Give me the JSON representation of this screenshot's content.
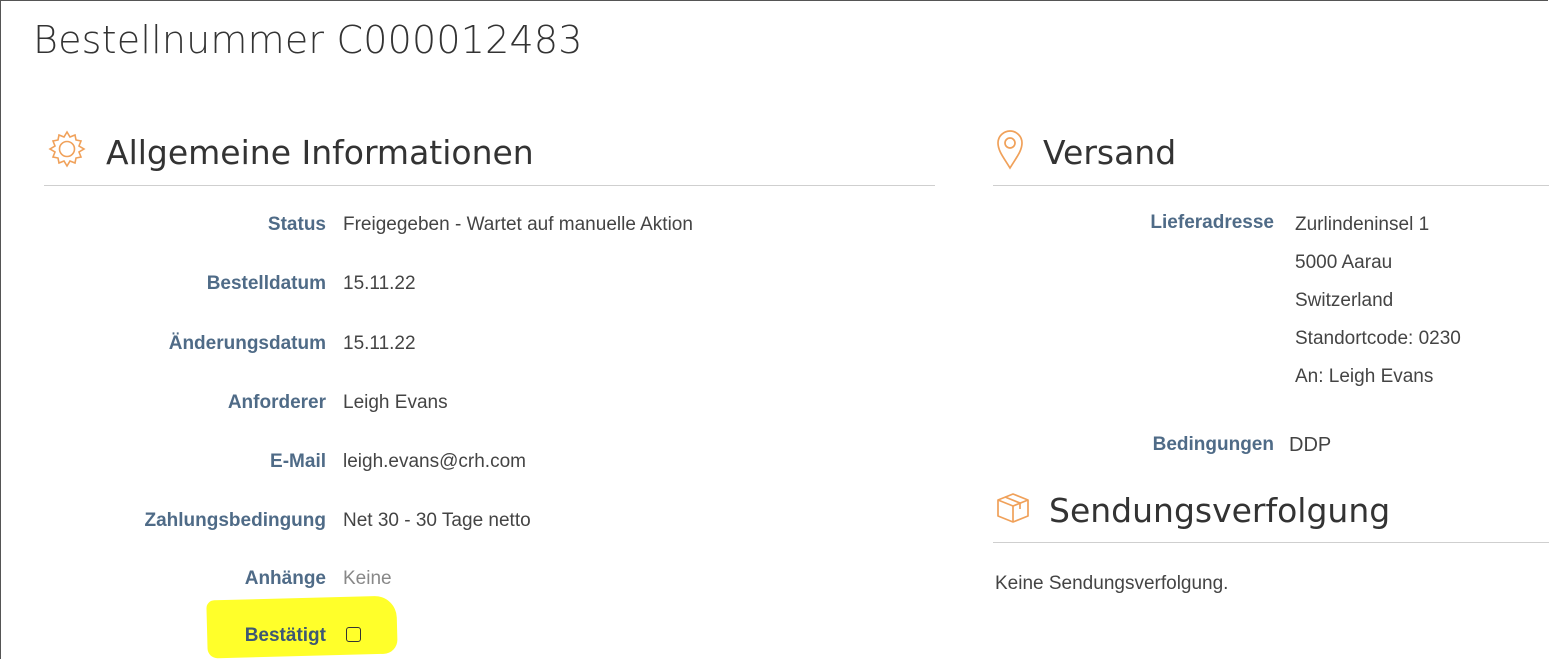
{
  "page_title": "Bestellnummer C000012483",
  "general": {
    "title": "Allgemeine Informationen",
    "icon": "gear-icon",
    "fields": [
      {
        "label": "Status",
        "value": "Freigegeben - Wartet auf manuelle Aktion"
      },
      {
        "label": "Bestelldatum",
        "value": "15.11.22"
      },
      {
        "label": "Änderungsdatum",
        "value": "15.11.22"
      },
      {
        "label": "Anforderer",
        "value": "Leigh Evans"
      },
      {
        "label": "E-Mail",
        "value": "leigh.evans@crh.com"
      },
      {
        "label": "Zahlungsbedingung",
        "value": "Net 30 - 30 Tage netto"
      },
      {
        "label": "Anhänge",
        "value": "Keine"
      },
      {
        "label": "Bestätigt",
        "checked": false
      }
    ]
  },
  "shipping": {
    "title": "Versand",
    "icon": "map-pin-icon",
    "address_label": "Lieferadresse",
    "address_lines": [
      "Zurlindeninsel 1",
      "5000 Aarau",
      "Switzerland",
      "Standortcode: 0230",
      "An: Leigh Evans"
    ],
    "terms_label": "Bedingungen",
    "terms_value": "DDP"
  },
  "tracking": {
    "title": "Sendungsverfolgung",
    "icon": "package-icon",
    "empty_text": "Keine Sendungsverfolgung."
  },
  "colors": {
    "accent_orange": "#f0a15a",
    "label_blue": "#4f6b87",
    "highlight_yellow": "#ffff2a"
  }
}
